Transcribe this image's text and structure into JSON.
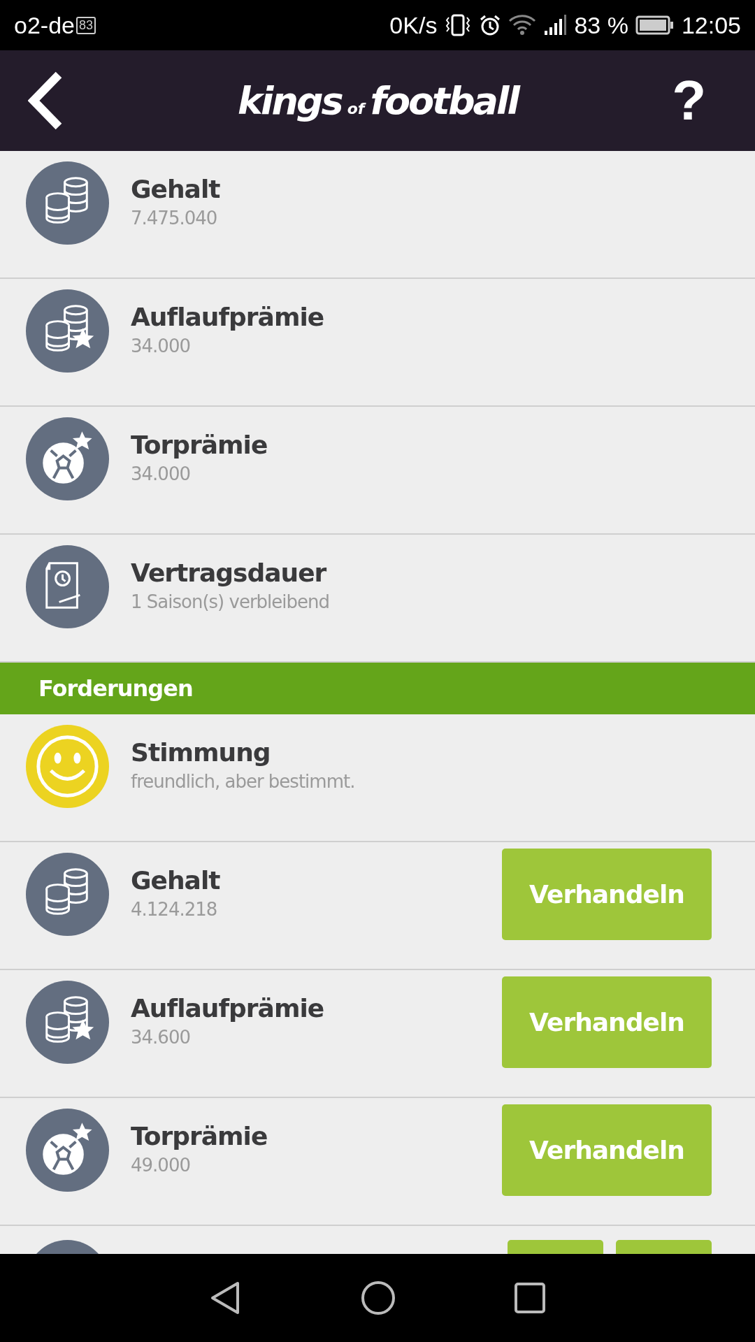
{
  "status_bar": {
    "carrier": "o2-de",
    "badge": "83",
    "speed": "0K/s",
    "battery": "83 %",
    "time": "12:05"
  },
  "header": {
    "logo": [
      "kings",
      "of",
      "football"
    ],
    "help": "?"
  },
  "contract": [
    {
      "kind": "coins",
      "title": "Gehalt",
      "value": "7.475.040"
    },
    {
      "kind": "bonus",
      "title": "Auflaufprämie",
      "value": "34.000"
    },
    {
      "kind": "goal",
      "title": "Torprämie",
      "value": "34.000"
    },
    {
      "kind": "duration",
      "title": "Vertragsdauer",
      "value": "1 Saison(s) verbleibend"
    }
  ],
  "section": "Forderungen",
  "mood": {
    "title": "Stimmung",
    "value": "freundlich, aber bestimmt."
  },
  "demands": [
    {
      "kind": "coins",
      "title": "Gehalt",
      "value": "4.124.218",
      "button": "Verhandeln"
    },
    {
      "kind": "bonus",
      "title": "Auflaufprämie",
      "value": "34.600",
      "button": "Verhandeln"
    },
    {
      "kind": "goal",
      "title": "Torprämie",
      "value": "49.000",
      "button": "Verhandeln"
    }
  ]
}
